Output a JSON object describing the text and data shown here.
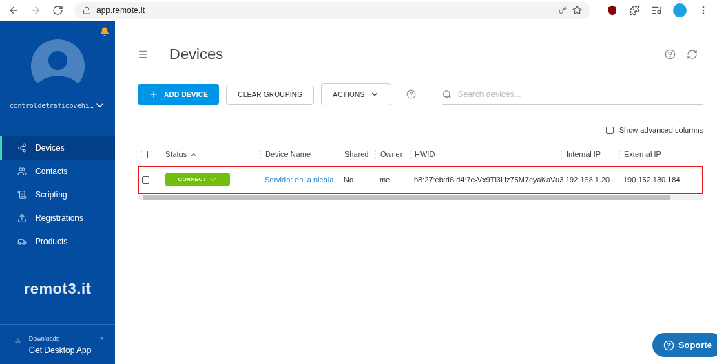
{
  "browser": {
    "url": "app.remote.it"
  },
  "sidebar": {
    "username": "controldetraficovehi…",
    "items": [
      {
        "label": "Devices",
        "selected": true
      },
      {
        "label": "Contacts",
        "selected": false
      },
      {
        "label": "Scripting",
        "selected": false
      },
      {
        "label": "Registrations",
        "selected": false
      },
      {
        "label": "Products",
        "selected": false
      }
    ],
    "logo": "remot3.it",
    "downloads": {
      "caption": "Downloads",
      "label": "Get Desktop App"
    }
  },
  "header": {
    "title": "Devices"
  },
  "toolbar": {
    "add": "ADD DEVICE",
    "clear": "CLEAR GROUPING",
    "actions": "ACTIONS",
    "search_placeholder": "Search devices..."
  },
  "advanced": {
    "label": "Show advanced columns",
    "checked": false
  },
  "table": {
    "all_checked": false,
    "columns": [
      "Status",
      "Device Name",
      "Shared",
      "Owner",
      "HWID",
      "Internal IP",
      "External IP"
    ],
    "rows": [
      {
        "checked": false,
        "highlighted": true,
        "connect": "CONNECT",
        "name": "Servidor en la niebla",
        "shared": "No",
        "owner": "me",
        "hwid": "b8:27:eb:d6:d4:7c-Vx9Tl3Hz75M7eyaKaVu3",
        "internal_ip": "192.168.1.20",
        "external_ip": "190.152.130.184"
      }
    ]
  },
  "support": {
    "label": "Soporte"
  }
}
